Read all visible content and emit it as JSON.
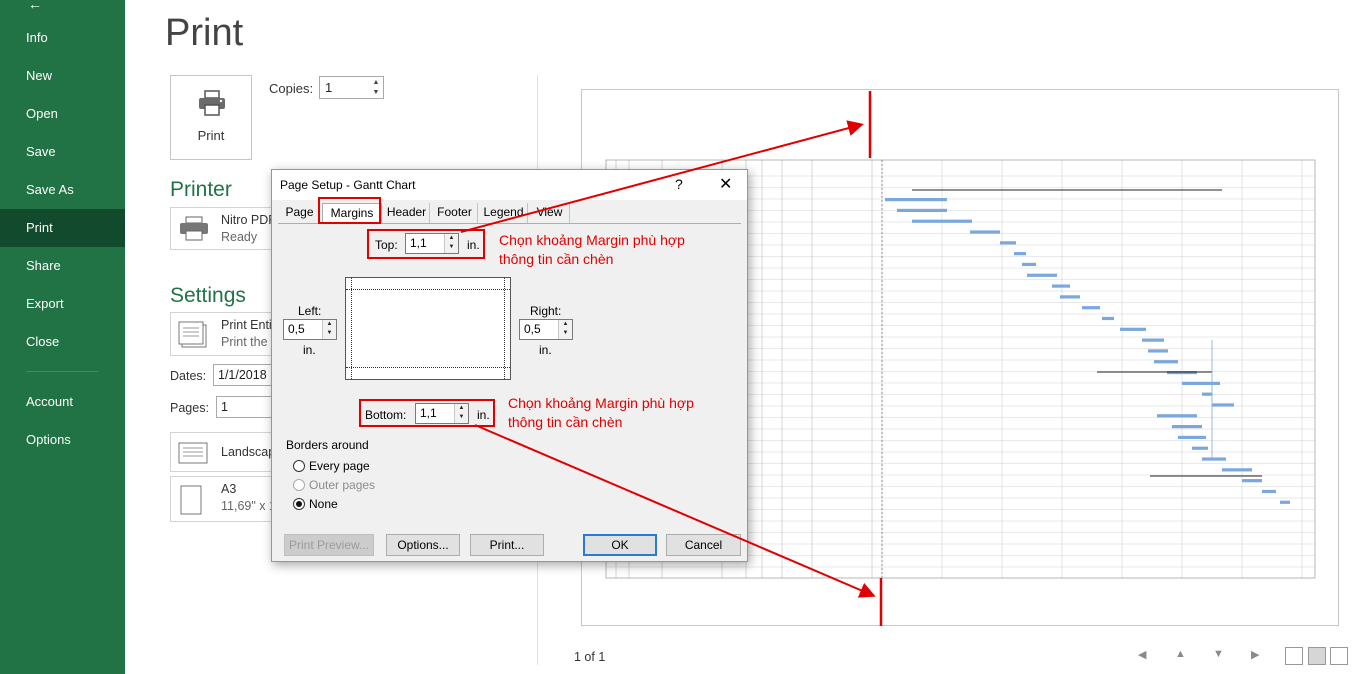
{
  "sidebar": {
    "items": [
      {
        "label": "Info"
      },
      {
        "label": "New"
      },
      {
        "label": "Open"
      },
      {
        "label": "Save"
      },
      {
        "label": "Save As"
      },
      {
        "label": "Print"
      },
      {
        "label": "Share"
      },
      {
        "label": "Export"
      },
      {
        "label": "Close"
      },
      {
        "label": "Account"
      },
      {
        "label": "Options"
      }
    ],
    "active": "Print"
  },
  "main": {
    "title": "Print",
    "print_button": "Print",
    "copies_label": "Copies:",
    "copies_value": "1",
    "printer_heading": "Printer",
    "printer_name": "Nitro PDF",
    "printer_status": "Ready",
    "settings_heading": "Settings",
    "print_entire_title": "Print Entir",
    "print_entire_desc": "Print the p",
    "dates_label": "Dates:",
    "dates_value": "1/1/2018",
    "pages_label": "Pages:",
    "pages_value": "1",
    "pages_value2": "1",
    "orientation": "Landscap",
    "paper_name": "A3",
    "paper_size": "11,69\" x 16"
  },
  "preview": {
    "page_count": "1 of 1"
  },
  "dialog": {
    "title": "Page Setup - Gantt Chart",
    "help": "?",
    "close": "✕",
    "tabs": [
      "Page",
      "Margins",
      "Header",
      "Footer",
      "Legend",
      "View"
    ],
    "active_tab": "Margins",
    "top_label": "Top:",
    "top_value": "1,1",
    "top_unit": "in.",
    "left_label": "Left:",
    "left_value": "0,5",
    "left_unit": "in.",
    "right_label": "Right:",
    "right_value": "0,5",
    "right_unit": "in.",
    "bottom_label": "Bottom:",
    "bottom_value": "1,1",
    "bottom_unit": "in.",
    "borders_heading": "Borders around",
    "borders_options": [
      {
        "label": "Every page",
        "checked": false,
        "disabled": false
      },
      {
        "label": "Outer pages",
        "checked": false,
        "disabled": true
      },
      {
        "label": "None",
        "checked": true,
        "disabled": false
      }
    ],
    "buttons": {
      "print_preview": "Print Preview...",
      "options": "Options...",
      "print": "Print...",
      "ok": "OK",
      "cancel": "Cancel"
    }
  },
  "annotations": {
    "note_top_line1": "Chọn khoảng Margin phù hợp",
    "note_top_line2": "thông tin cần chèn",
    "note_bottom_line1": "Chọn khoảng Margin phù hợp",
    "note_bottom_line2": "thông tin cần chèn",
    "color": "#e00000"
  },
  "colors": {
    "sidebar": "#217346",
    "sidebar_active": "#114a2c",
    "accent_green": "#217346",
    "gantt_bar": "#7aa7dc"
  }
}
